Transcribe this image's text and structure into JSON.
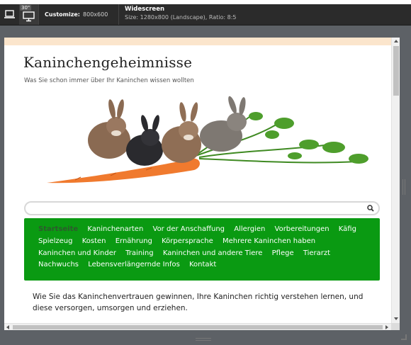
{
  "toolbar": {
    "laptop_icon": "laptop-icon",
    "desktop_icon": "desktop-icon",
    "desktop_badge": "30\"",
    "customize_label": "Customize:",
    "customize_value": "800x600",
    "edit_icon": "pencil-icon",
    "device_name": "Widescreen",
    "device_spec": "Size: 1280x800 (Landscape), Ratio: 8:5"
  },
  "site": {
    "title": "Kaninchengeheimnisse",
    "tagline": "Was Sie schon immer über Ihr Kaninchen wissen wollten",
    "hero_image": "rabbits-with-carrot-image",
    "search_placeholder": "",
    "search_icon": "magnifier-icon",
    "nav": [
      "Startseite",
      "Kaninchenarten",
      "Vor der Anschaffung",
      "Allergien",
      "Vorbereitungen",
      "Käfig",
      "Spielzeug",
      "Kosten",
      "Ernährung",
      "Körpersprache",
      "Mehrere Kaninchen haben",
      "Kaninchen und Kinder",
      "Training",
      "Kaninchen und andere Tiere",
      "Pflege",
      "Tierarzt",
      "Nachwuchs",
      "Lebensverlängernde Infos",
      "Kontakt"
    ],
    "intro": "Wie Sie das Kaninchenvertrauen gewinnen, Ihre Kaninchen richtig verstehen lernen, und diese versorgen, umsorgen und erziehen."
  },
  "colors": {
    "toolbar_bg": "#2b2b2b",
    "workspace_bg": "#5d6166",
    "header_band": "#fbe5cc",
    "nav_green": "#0a9a12",
    "nav_current": "#2d5a2d",
    "carrot": "#f07a2e"
  }
}
